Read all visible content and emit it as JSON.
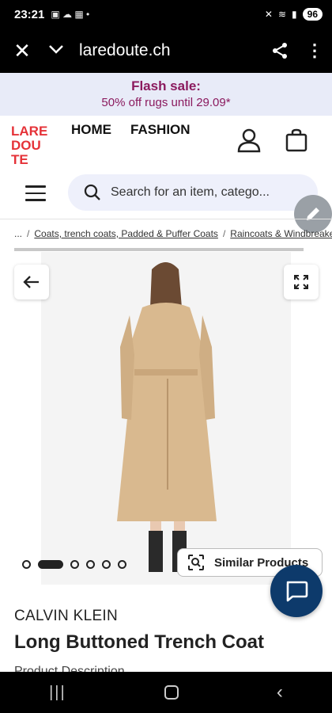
{
  "status_bar": {
    "time": "23:21",
    "battery": "96"
  },
  "browser": {
    "url": "laredoute.ch"
  },
  "flash_banner": {
    "title": "Flash sale:",
    "subtitle": "50% off rugs until 29.09*"
  },
  "header": {
    "logo_text": [
      "LARE",
      "DOU",
      "TE"
    ],
    "nav": [
      "HOME",
      "FASHION"
    ]
  },
  "search": {
    "placeholder": "Search for an item, catego..."
  },
  "breadcrumb": {
    "ellipsis": "...",
    "items": [
      "Coats, trench coats, Padded & Puffer Coats",
      "Raincoats & Windbreakers"
    ]
  },
  "gallery": {
    "dot_count": 6,
    "active_dot": 1,
    "similar_label": "Similar Products"
  },
  "product": {
    "brand": "CALVIN KLEIN",
    "title": "Long Buttoned Trench Coat",
    "description_label": "Product Description"
  },
  "colors": {
    "flash_bg": "#e8ebf8",
    "flash_text": "#8b1a5e",
    "logo_red": "#e53238",
    "chat_fab": "#0d3a6b",
    "coat": "#d9b98f"
  }
}
